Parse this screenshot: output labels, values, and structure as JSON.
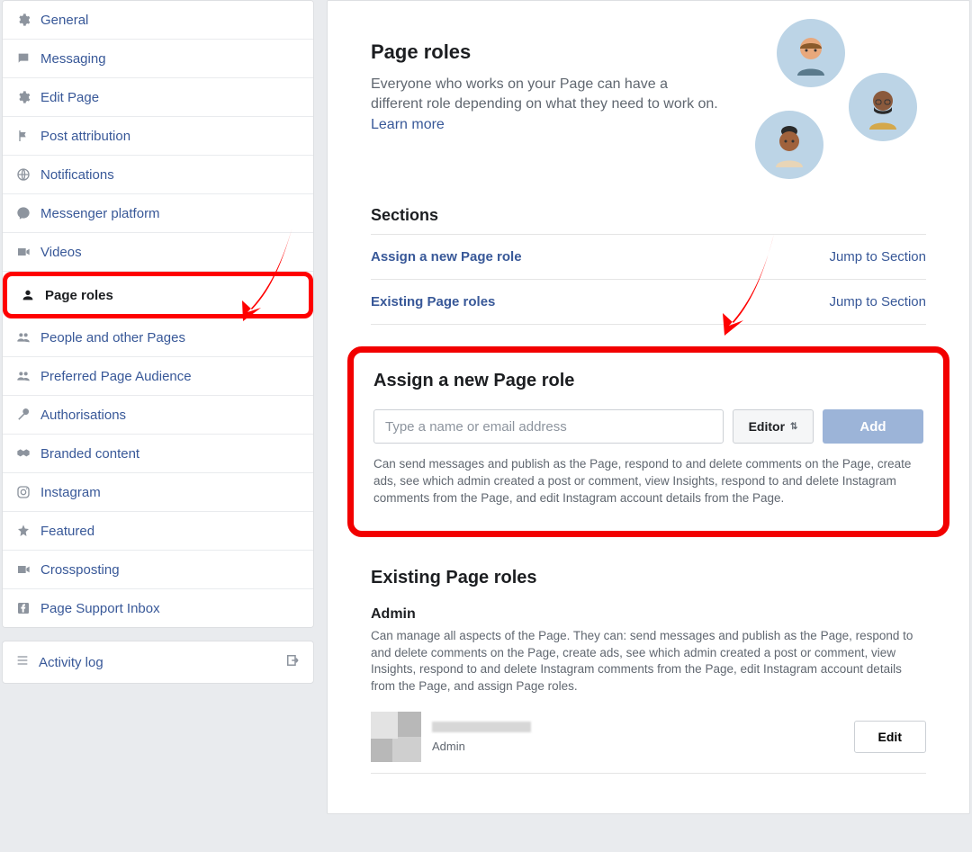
{
  "sidebar": {
    "items": [
      {
        "label": "General"
      },
      {
        "label": "Messaging"
      },
      {
        "label": "Edit Page"
      },
      {
        "label": "Post attribution"
      },
      {
        "label": "Notifications"
      },
      {
        "label": "Messenger platform"
      },
      {
        "label": "Videos"
      },
      {
        "label": "Page roles"
      },
      {
        "label": "People and other Pages"
      },
      {
        "label": "Preferred Page Audience"
      },
      {
        "label": "Authorisations"
      },
      {
        "label": "Branded content"
      },
      {
        "label": "Instagram"
      },
      {
        "label": "Featured"
      },
      {
        "label": "Crossposting"
      },
      {
        "label": "Page Support Inbox"
      }
    ],
    "activity_log": "Activity log"
  },
  "header": {
    "title": "Page roles",
    "description": "Everyone who works on your Page can have a different role depending on what they need to work on. ",
    "learn_more": "Learn more"
  },
  "sections": {
    "title": "Sections",
    "rows": [
      {
        "left": "Assign a new Page role",
        "right": "Jump to Section"
      },
      {
        "left": "Existing Page roles",
        "right": "Jump to Section"
      }
    ]
  },
  "assign": {
    "title": "Assign a new Page role",
    "placeholder": "Type a name or email address",
    "role_selected": "Editor",
    "add_label": "Add",
    "description": "Can send messages and publish as the Page, respond to and delete comments on the Page, create ads, see which admin created a post or comment, view Insights, respond to and delete Instagram comments from the Page, and edit Instagram account details from the Page."
  },
  "existing": {
    "title": "Existing Page roles",
    "role_name": "Admin",
    "role_desc": "Can manage all aspects of the Page. They can: send messages and publish as the Page, respond to and delete comments on the Page, create ads, see which admin created a post or comment, view Insights, respond to and delete Instagram comments from the Page, edit Instagram account details from the Page, and assign Page roles.",
    "user_role": "Admin",
    "edit_label": "Edit"
  }
}
